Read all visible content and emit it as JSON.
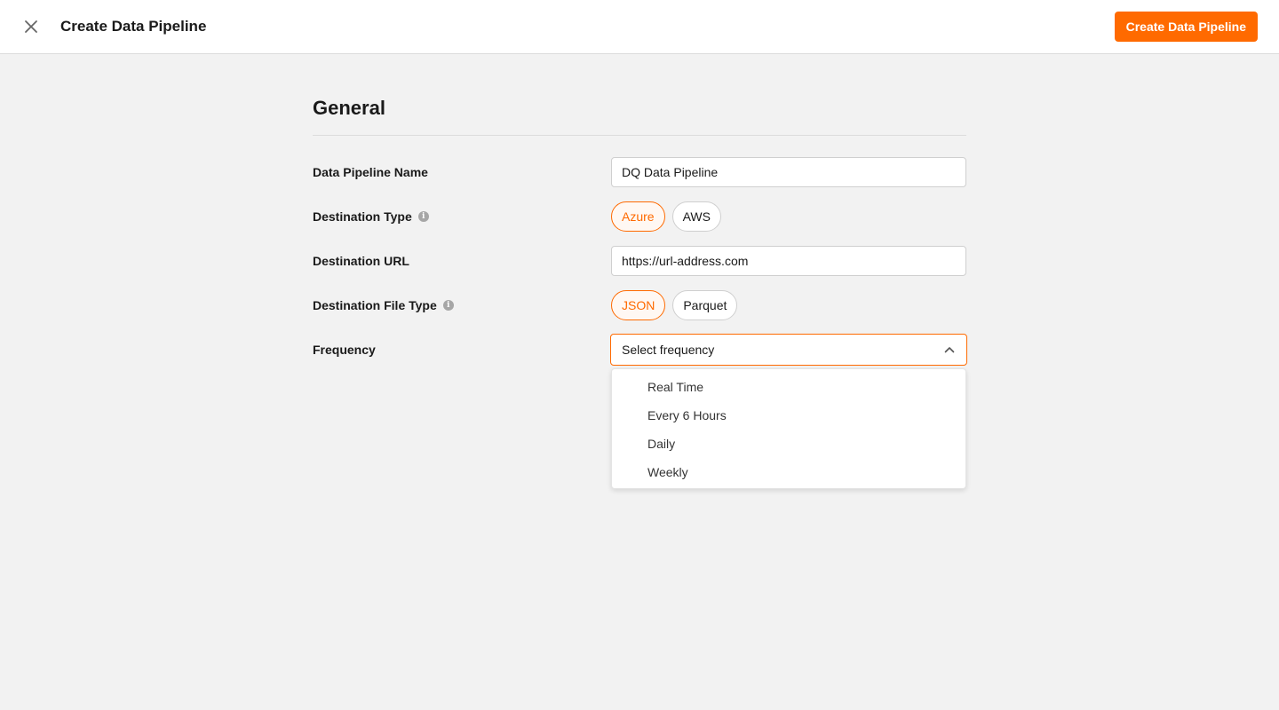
{
  "header": {
    "title": "Create Data Pipeline",
    "primary_button_label": "Create Data Pipeline",
    "close_icon": "close-icon"
  },
  "section": {
    "title": "General"
  },
  "fields": {
    "pipeline_name": {
      "label": "Data Pipeline Name",
      "value": "DQ Data Pipeline"
    },
    "destination_type": {
      "label": "Destination Type",
      "info_icon": "info-icon",
      "options": [
        "Azure",
        "AWS"
      ],
      "selected": "Azure"
    },
    "destination_url": {
      "label": "Destination URL",
      "value": "https://url-address.com"
    },
    "destination_file_type": {
      "label": "Destination File Type",
      "info_icon": "info-icon",
      "options": [
        "JSON",
        "Parquet"
      ],
      "selected": "JSON"
    },
    "frequency": {
      "label": "Frequency",
      "placeholder": "Select frequency",
      "options": [
        "Real Time",
        "Every 6 Hours",
        "Daily",
        "Weekly"
      ],
      "expanded": true
    }
  },
  "colors": {
    "accent": "#ff6a00",
    "background": "#f2f2f2",
    "surface": "#ffffff"
  }
}
